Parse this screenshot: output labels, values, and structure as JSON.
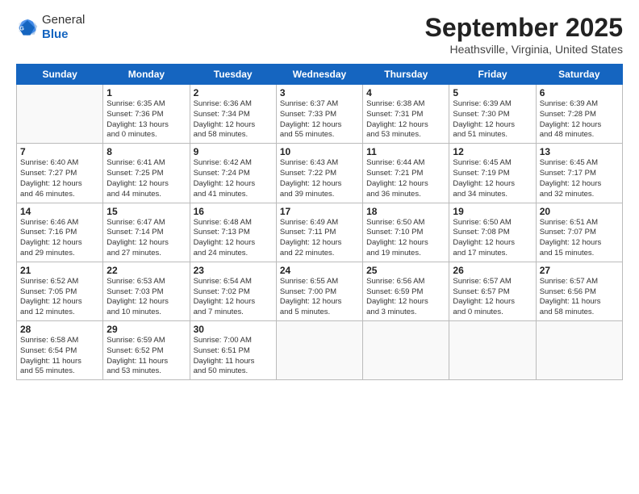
{
  "header": {
    "logo_line1": "General",
    "logo_line2": "Blue",
    "month_title": "September 2025",
    "location": "Heathsville, Virginia, United States"
  },
  "weekdays": [
    "Sunday",
    "Monday",
    "Tuesday",
    "Wednesday",
    "Thursday",
    "Friday",
    "Saturday"
  ],
  "weeks": [
    [
      {
        "day": "",
        "info": ""
      },
      {
        "day": "1",
        "info": "Sunrise: 6:35 AM\nSunset: 7:36 PM\nDaylight: 13 hours\nand 0 minutes."
      },
      {
        "day": "2",
        "info": "Sunrise: 6:36 AM\nSunset: 7:34 PM\nDaylight: 12 hours\nand 58 minutes."
      },
      {
        "day": "3",
        "info": "Sunrise: 6:37 AM\nSunset: 7:33 PM\nDaylight: 12 hours\nand 55 minutes."
      },
      {
        "day": "4",
        "info": "Sunrise: 6:38 AM\nSunset: 7:31 PM\nDaylight: 12 hours\nand 53 minutes."
      },
      {
        "day": "5",
        "info": "Sunrise: 6:39 AM\nSunset: 7:30 PM\nDaylight: 12 hours\nand 51 minutes."
      },
      {
        "day": "6",
        "info": "Sunrise: 6:39 AM\nSunset: 7:28 PM\nDaylight: 12 hours\nand 48 minutes."
      }
    ],
    [
      {
        "day": "7",
        "info": "Sunrise: 6:40 AM\nSunset: 7:27 PM\nDaylight: 12 hours\nand 46 minutes."
      },
      {
        "day": "8",
        "info": "Sunrise: 6:41 AM\nSunset: 7:25 PM\nDaylight: 12 hours\nand 44 minutes."
      },
      {
        "day": "9",
        "info": "Sunrise: 6:42 AM\nSunset: 7:24 PM\nDaylight: 12 hours\nand 41 minutes."
      },
      {
        "day": "10",
        "info": "Sunrise: 6:43 AM\nSunset: 7:22 PM\nDaylight: 12 hours\nand 39 minutes."
      },
      {
        "day": "11",
        "info": "Sunrise: 6:44 AM\nSunset: 7:21 PM\nDaylight: 12 hours\nand 36 minutes."
      },
      {
        "day": "12",
        "info": "Sunrise: 6:45 AM\nSunset: 7:19 PM\nDaylight: 12 hours\nand 34 minutes."
      },
      {
        "day": "13",
        "info": "Sunrise: 6:45 AM\nSunset: 7:17 PM\nDaylight: 12 hours\nand 32 minutes."
      }
    ],
    [
      {
        "day": "14",
        "info": "Sunrise: 6:46 AM\nSunset: 7:16 PM\nDaylight: 12 hours\nand 29 minutes."
      },
      {
        "day": "15",
        "info": "Sunrise: 6:47 AM\nSunset: 7:14 PM\nDaylight: 12 hours\nand 27 minutes."
      },
      {
        "day": "16",
        "info": "Sunrise: 6:48 AM\nSunset: 7:13 PM\nDaylight: 12 hours\nand 24 minutes."
      },
      {
        "day": "17",
        "info": "Sunrise: 6:49 AM\nSunset: 7:11 PM\nDaylight: 12 hours\nand 22 minutes."
      },
      {
        "day": "18",
        "info": "Sunrise: 6:50 AM\nSunset: 7:10 PM\nDaylight: 12 hours\nand 19 minutes."
      },
      {
        "day": "19",
        "info": "Sunrise: 6:50 AM\nSunset: 7:08 PM\nDaylight: 12 hours\nand 17 minutes."
      },
      {
        "day": "20",
        "info": "Sunrise: 6:51 AM\nSunset: 7:07 PM\nDaylight: 12 hours\nand 15 minutes."
      }
    ],
    [
      {
        "day": "21",
        "info": "Sunrise: 6:52 AM\nSunset: 7:05 PM\nDaylight: 12 hours\nand 12 minutes."
      },
      {
        "day": "22",
        "info": "Sunrise: 6:53 AM\nSunset: 7:03 PM\nDaylight: 12 hours\nand 10 minutes."
      },
      {
        "day": "23",
        "info": "Sunrise: 6:54 AM\nSunset: 7:02 PM\nDaylight: 12 hours\nand 7 minutes."
      },
      {
        "day": "24",
        "info": "Sunrise: 6:55 AM\nSunset: 7:00 PM\nDaylight: 12 hours\nand 5 minutes."
      },
      {
        "day": "25",
        "info": "Sunrise: 6:56 AM\nSunset: 6:59 PM\nDaylight: 12 hours\nand 3 minutes."
      },
      {
        "day": "26",
        "info": "Sunrise: 6:57 AM\nSunset: 6:57 PM\nDaylight: 12 hours\nand 0 minutes."
      },
      {
        "day": "27",
        "info": "Sunrise: 6:57 AM\nSunset: 6:56 PM\nDaylight: 11 hours\nand 58 minutes."
      }
    ],
    [
      {
        "day": "28",
        "info": "Sunrise: 6:58 AM\nSunset: 6:54 PM\nDaylight: 11 hours\nand 55 minutes."
      },
      {
        "day": "29",
        "info": "Sunrise: 6:59 AM\nSunset: 6:52 PM\nDaylight: 11 hours\nand 53 minutes."
      },
      {
        "day": "30",
        "info": "Sunrise: 7:00 AM\nSunset: 6:51 PM\nDaylight: 11 hours\nand 50 minutes."
      },
      {
        "day": "",
        "info": ""
      },
      {
        "day": "",
        "info": ""
      },
      {
        "day": "",
        "info": ""
      },
      {
        "day": "",
        "info": ""
      }
    ]
  ]
}
